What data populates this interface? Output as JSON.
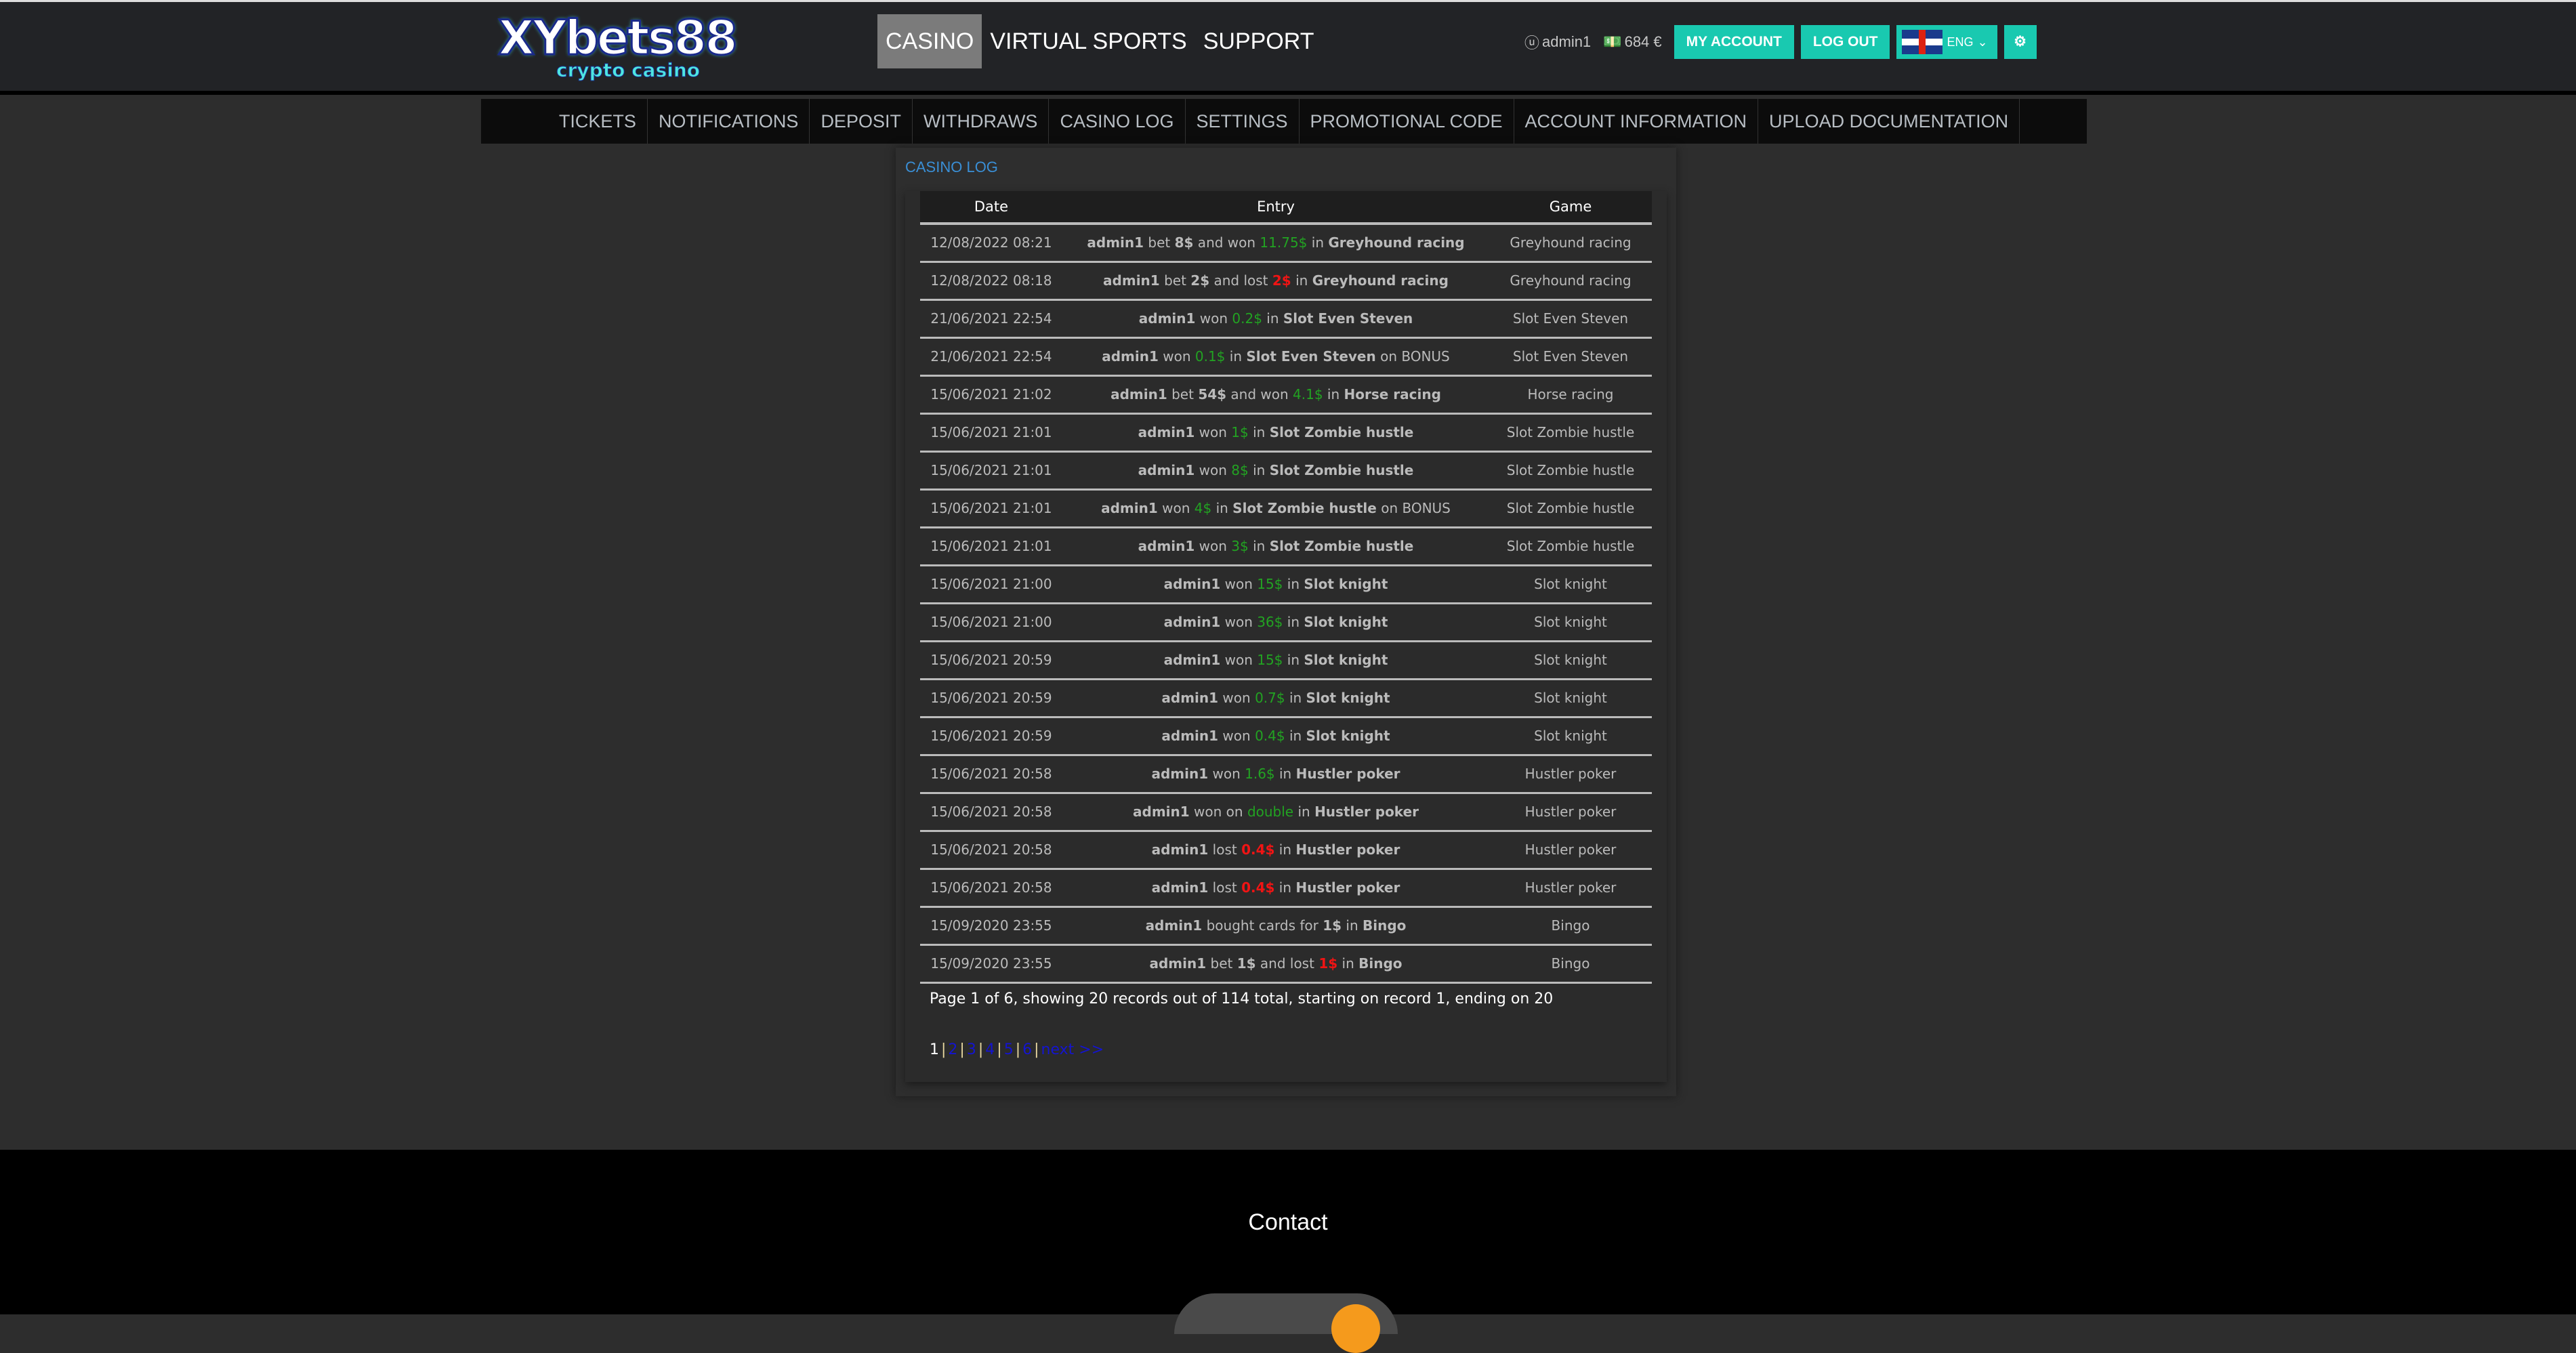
{
  "header": {
    "logo_text": "XYbets88",
    "logo_sub": "crypto casino",
    "nav": [
      {
        "label": "CASINO",
        "active": true
      },
      {
        "label": "VIRTUAL SPORTS"
      },
      {
        "label": "SUPPORT"
      }
    ],
    "user": "admin1",
    "balance": "684 €",
    "my_account": "MY ACCOUNT",
    "logout": "LOG OUT",
    "language": "ENG"
  },
  "subnav": [
    "TICKETS",
    "NOTIFICATIONS",
    "DEPOSIT",
    "WITHDRAWS",
    "CASINO LOG",
    "SETTINGS",
    "PROMOTIONAL CODE",
    "ACCOUNT INFORMATION",
    "UPLOAD DOCUMENTATION"
  ],
  "log": {
    "title": "CASINO LOG",
    "columns": [
      "Date",
      "Entry",
      "Game"
    ],
    "rows": [
      {
        "date": "12/08/2022 08:21",
        "entry": [
          [
            "b",
            "admin1"
          ],
          [
            "n",
            " bet "
          ],
          [
            "b",
            "8$"
          ],
          [
            "n",
            " and won "
          ],
          [
            "g",
            "11.75$"
          ],
          [
            "n",
            " in "
          ],
          [
            "b",
            "Greyhound racing"
          ]
        ],
        "game": "Greyhound racing"
      },
      {
        "date": "12/08/2022 08:18",
        "entry": [
          [
            "b",
            "admin1"
          ],
          [
            "n",
            " bet "
          ],
          [
            "b",
            "2$"
          ],
          [
            "n",
            " and lost "
          ],
          [
            "r",
            "2$"
          ],
          [
            "n",
            " in "
          ],
          [
            "b",
            "Greyhound racing"
          ]
        ],
        "game": "Greyhound racing"
      },
      {
        "date": "21/06/2021 22:54",
        "entry": [
          [
            "b",
            "admin1"
          ],
          [
            "n",
            " won "
          ],
          [
            "g",
            "0.2$"
          ],
          [
            "n",
            " in "
          ],
          [
            "b",
            "Slot Even Steven"
          ]
        ],
        "game": "Slot Even Steven"
      },
      {
        "date": "21/06/2021 22:54",
        "entry": [
          [
            "b",
            "admin1"
          ],
          [
            "n",
            " won "
          ],
          [
            "g",
            "0.1$"
          ],
          [
            "n",
            " in "
          ],
          [
            "b",
            "Slot Even Steven"
          ],
          [
            "n",
            " on BONUS"
          ]
        ],
        "game": "Slot Even Steven"
      },
      {
        "date": "15/06/2021 21:02",
        "entry": [
          [
            "b",
            "admin1"
          ],
          [
            "n",
            " bet "
          ],
          [
            "b",
            "54$"
          ],
          [
            "n",
            " and won "
          ],
          [
            "g",
            "4.1$"
          ],
          [
            "n",
            " in "
          ],
          [
            "b",
            "Horse racing"
          ]
        ],
        "game": "Horse racing"
      },
      {
        "date": "15/06/2021 21:01",
        "entry": [
          [
            "b",
            "admin1"
          ],
          [
            "n",
            " won "
          ],
          [
            "g",
            "1$"
          ],
          [
            "n",
            " in "
          ],
          [
            "b",
            "Slot Zombie hustle"
          ]
        ],
        "game": "Slot Zombie hustle"
      },
      {
        "date": "15/06/2021 21:01",
        "entry": [
          [
            "b",
            "admin1"
          ],
          [
            "n",
            " won "
          ],
          [
            "g",
            "8$"
          ],
          [
            "n",
            " in "
          ],
          [
            "b",
            "Slot Zombie hustle"
          ]
        ],
        "game": "Slot Zombie hustle"
      },
      {
        "date": "15/06/2021 21:01",
        "entry": [
          [
            "b",
            "admin1"
          ],
          [
            "n",
            " won "
          ],
          [
            "g",
            "4$"
          ],
          [
            "n",
            " in "
          ],
          [
            "b",
            "Slot Zombie hustle"
          ],
          [
            "n",
            " on BONUS"
          ]
        ],
        "game": "Slot Zombie hustle"
      },
      {
        "date": "15/06/2021 21:01",
        "entry": [
          [
            "b",
            "admin1"
          ],
          [
            "n",
            " won "
          ],
          [
            "g",
            "3$"
          ],
          [
            "n",
            " in "
          ],
          [
            "b",
            "Slot Zombie hustle"
          ]
        ],
        "game": "Slot Zombie hustle"
      },
      {
        "date": "15/06/2021 21:00",
        "entry": [
          [
            "b",
            "admin1"
          ],
          [
            "n",
            " won "
          ],
          [
            "g",
            "15$"
          ],
          [
            "n",
            " in "
          ],
          [
            "b",
            "Slot knight"
          ]
        ],
        "game": "Slot knight"
      },
      {
        "date": "15/06/2021 21:00",
        "entry": [
          [
            "b",
            "admin1"
          ],
          [
            "n",
            " won "
          ],
          [
            "g",
            "36$"
          ],
          [
            "n",
            " in "
          ],
          [
            "b",
            "Slot knight"
          ]
        ],
        "game": "Slot knight"
      },
      {
        "date": "15/06/2021 20:59",
        "entry": [
          [
            "b",
            "admin1"
          ],
          [
            "n",
            " won "
          ],
          [
            "g",
            "15$"
          ],
          [
            "n",
            " in "
          ],
          [
            "b",
            "Slot knight"
          ]
        ],
        "game": "Slot knight"
      },
      {
        "date": "15/06/2021 20:59",
        "entry": [
          [
            "b",
            "admin1"
          ],
          [
            "n",
            " won "
          ],
          [
            "g",
            "0.7$"
          ],
          [
            "n",
            " in "
          ],
          [
            "b",
            "Slot knight"
          ]
        ],
        "game": "Slot knight"
      },
      {
        "date": "15/06/2021 20:59",
        "entry": [
          [
            "b",
            "admin1"
          ],
          [
            "n",
            " won "
          ],
          [
            "g",
            "0.4$"
          ],
          [
            "n",
            " in "
          ],
          [
            "b",
            "Slot knight"
          ]
        ],
        "game": "Slot knight"
      },
      {
        "date": "15/06/2021 20:58",
        "entry": [
          [
            "b",
            "admin1"
          ],
          [
            "n",
            " won "
          ],
          [
            "g",
            "1.6$"
          ],
          [
            "n",
            " in "
          ],
          [
            "b",
            "Hustler poker"
          ]
        ],
        "game": "Hustler poker"
      },
      {
        "date": "15/06/2021 20:58",
        "entry": [
          [
            "b",
            "admin1"
          ],
          [
            "n",
            " won on "
          ],
          [
            "g",
            "double"
          ],
          [
            "n",
            " in "
          ],
          [
            "b",
            "Hustler poker"
          ]
        ],
        "game": "Hustler poker"
      },
      {
        "date": "15/06/2021 20:58",
        "entry": [
          [
            "b",
            "admin1"
          ],
          [
            "n",
            " lost "
          ],
          [
            "r",
            "0.4$"
          ],
          [
            "n",
            " in "
          ],
          [
            "b",
            "Hustler poker"
          ]
        ],
        "game": "Hustler poker"
      },
      {
        "date": "15/06/2021 20:58",
        "entry": [
          [
            "b",
            "admin1"
          ],
          [
            "n",
            " lost "
          ],
          [
            "r",
            "0.4$"
          ],
          [
            "n",
            " in "
          ],
          [
            "b",
            "Hustler poker"
          ]
        ],
        "game": "Hustler poker"
      },
      {
        "date": "15/09/2020 23:55",
        "entry": [
          [
            "b",
            "admin1"
          ],
          [
            "n",
            " bought cards for "
          ],
          [
            "b",
            "1$"
          ],
          [
            "n",
            " in "
          ],
          [
            "b",
            "Bingo"
          ]
        ],
        "game": "Bingo"
      },
      {
        "date": "15/09/2020 23:55",
        "entry": [
          [
            "b",
            "admin1"
          ],
          [
            "n",
            " bet "
          ],
          [
            "b",
            "1$"
          ],
          [
            "n",
            " and lost "
          ],
          [
            "r",
            "1$"
          ],
          [
            "n",
            " in "
          ],
          [
            "b",
            "Bingo"
          ]
        ],
        "game": "Bingo"
      }
    ],
    "summary": "Page 1 of 6, showing 20 records out of 114 total, starting on record 1, ending on 20",
    "pagination": {
      "current": "1",
      "pages": [
        "2",
        "3",
        "4",
        "5",
        "6"
      ],
      "next": "next >>"
    }
  },
  "footer": {
    "contact": "Contact"
  },
  "colors": {
    "accent": "#19c9b0",
    "win": "#22a322",
    "loss": "#f01414",
    "link": "#1414d0",
    "title": "#3a8fd6"
  }
}
